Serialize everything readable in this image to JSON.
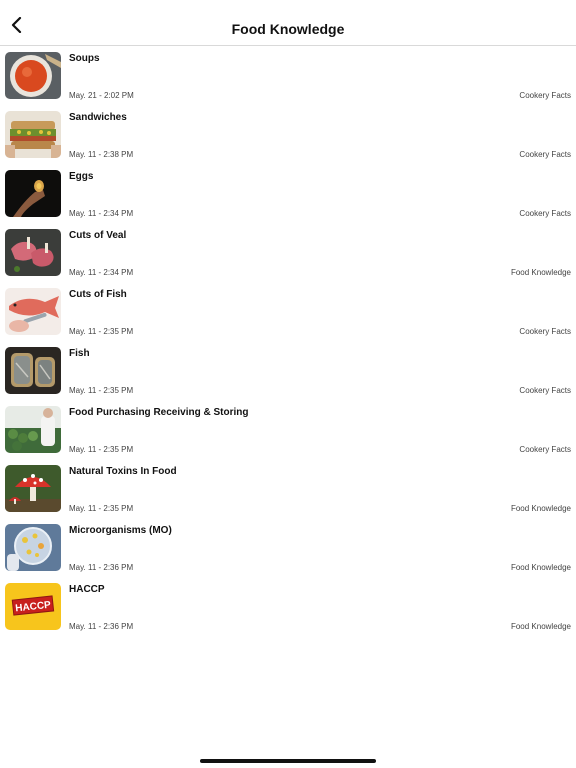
{
  "header": {
    "title": "Food Knowledge",
    "back_icon": "chevron-left-icon"
  },
  "items": [
    {
      "title": "Soups",
      "date": "May. 21 - 2:02 PM",
      "category": "Cookery Facts"
    },
    {
      "title": "Sandwiches",
      "date": "May. 11 - 2:38 PM",
      "category": "Cookery Facts"
    },
    {
      "title": "Eggs",
      "date": "May. 11 - 2:34 PM",
      "category": "Cookery Facts"
    },
    {
      "title": "Cuts of Veal",
      "date": "May. 11 - 2:34 PM",
      "category": "Food Knowledge"
    },
    {
      "title": "Cuts of Fish",
      "date": "May. 11 - 2:35 PM",
      "category": "Cookery Facts"
    },
    {
      "title": "Fish",
      "date": "May. 11 - 2:35 PM",
      "category": "Cookery Facts"
    },
    {
      "title": "Food Purchasing Receiving & Storing",
      "date": "May. 11 - 2:35 PM",
      "category": "Cookery Facts"
    },
    {
      "title": "Natural Toxins In Food",
      "date": "May. 11 - 2:35 PM",
      "category": "Food Knowledge"
    },
    {
      "title": "Microorganisms (MO)",
      "date": "May. 11 - 2:36 PM",
      "category": "Food Knowledge"
    },
    {
      "title": "HACCP",
      "date": "May. 11 - 2:36 PM",
      "category": "Food Knowledge",
      "logo_text": "HACCP"
    }
  ],
  "colors": {
    "divider": "#d9d9d9",
    "haccp_bg": "#f7c51c",
    "haccp_badge": "#c8201d"
  }
}
